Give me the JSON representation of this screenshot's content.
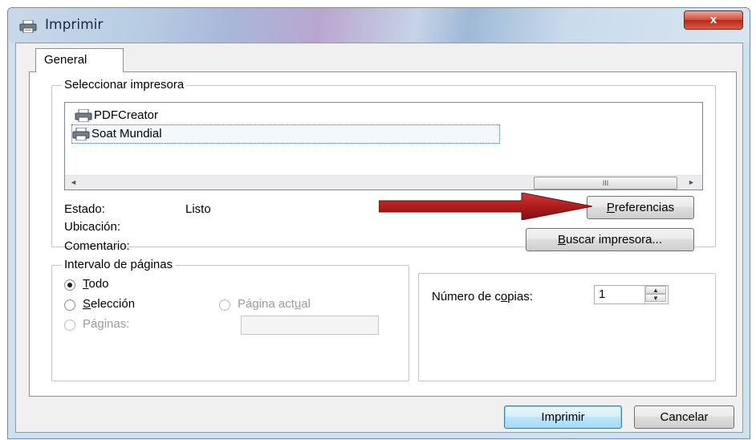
{
  "window": {
    "title": "Imprimir",
    "close_glyph": "x"
  },
  "tabs": [
    {
      "label": "General"
    }
  ],
  "printer_group": {
    "label": "Seleccionar impresora",
    "printers": [
      {
        "name": "PDFCreator"
      },
      {
        "name": "Soat Mundial"
      }
    ],
    "scrollbar": {
      "left_glyph": "◄",
      "right_glyph": "►",
      "thumb_glyph": "III"
    },
    "status_label": "Estado:",
    "status_value": "Listo",
    "location_label": "Ubicación:",
    "comment_label": "Comentario:",
    "preferences_button": {
      "prefix": "",
      "accel": "P",
      "rest": "referencias"
    },
    "find_button": {
      "prefix": "",
      "accel": "B",
      "rest": "uscar impresora..."
    }
  },
  "page_range_group": {
    "label": "Intervalo de páginas",
    "all": {
      "prefix": "",
      "accel": "T",
      "rest": "odo"
    },
    "selection": {
      "prefix": "",
      "accel": "S",
      "rest": "elección"
    },
    "current_page": {
      "prefix": "Página act",
      "accel": "u",
      "rest": "al"
    },
    "pages": {
      "prefix": "Páginas:",
      "accel": "",
      "rest": ""
    },
    "pages_value": ""
  },
  "copies_group": {
    "label": {
      "prefix": "Número de c",
      "accel": "o",
      "rest": "pias:"
    },
    "value": "1"
  },
  "footer": {
    "print_label": "Imprimir",
    "cancel_label": "Cancelar"
  },
  "icons": {
    "printer": "printer-icon",
    "annotation_arrow": "red-arrow-icon"
  },
  "colors": {
    "arrow": "#b01c1c",
    "selection_border": "#3a6ea5",
    "default_button_border": "#3c7fb1"
  }
}
